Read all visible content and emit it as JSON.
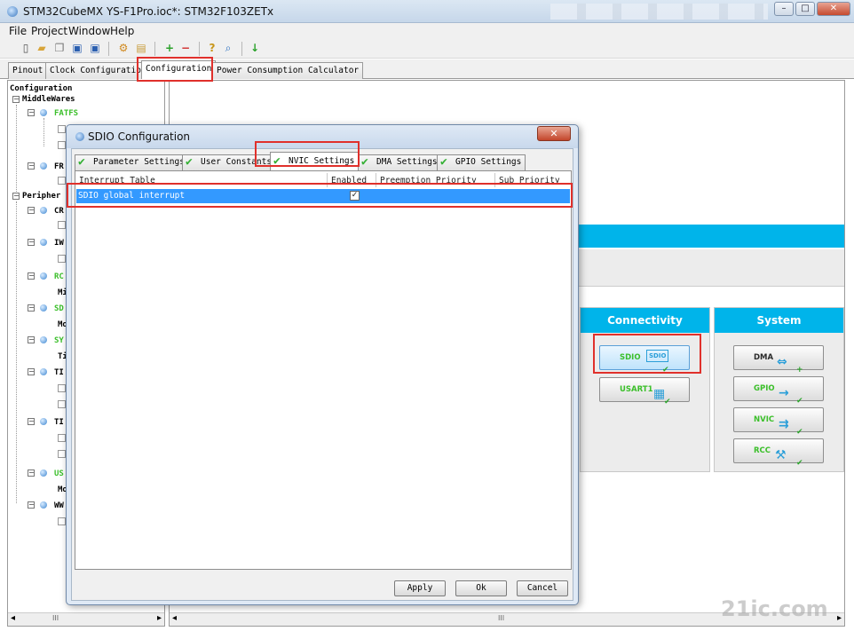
{
  "window": {
    "title": "STM32CubeMX YS-F1Pro.ioc*: STM32F103ZETx",
    "min_label": "–",
    "max_label": "□",
    "close_label": "✕"
  },
  "menu": [
    "File",
    "Project",
    "Window",
    "Help"
  ],
  "toolbar_icons": [
    "new-project-icon",
    "open-icon",
    "copy-icon",
    "save-icon",
    "save-as-icon",
    "generate-report-icon",
    "report-icon",
    "zoom-in-icon",
    "zoom-out-icon",
    "help-icon",
    "search-icon",
    "generate-code-icon"
  ],
  "main_tabs": [
    {
      "label": "Pinout"
    },
    {
      "label": "Clock Configuration"
    },
    {
      "label": "Configuration"
    },
    {
      "label": "Power Consumption Calculator"
    }
  ],
  "tree": {
    "root": "Configuration",
    "middlewares": "MiddleWares",
    "fatfs": "FATFS",
    "fr": "FR",
    "peripherals": "Peripher",
    "cr": "CR",
    "iw": "IW",
    "rc": "RC",
    "sd": "SD",
    "sy": "SY",
    "ti1": "TI",
    "ti2": "TI",
    "us": "US",
    "ww": "WW",
    "mi": "Mi",
    "mo1": "Mo",
    "mo2": "Mo",
    "ti_leaf": "Ti",
    "scroll_left": "◂",
    "scroll_right": "▸",
    "scroll_grip": "III"
  },
  "categories": {
    "connectivity": {
      "title": "Connectivity",
      "buttons": [
        {
          "label": "SDIO",
          "icon": "sdio-icon",
          "icon_text": "SDIO"
        },
        {
          "label": "USART1",
          "icon": "usart-icon",
          "icon_text": "▦"
        }
      ]
    },
    "system": {
      "title": "System",
      "buttons": [
        {
          "label": "DMA",
          "icon": "dma-icon",
          "icon_text": "⇔"
        },
        {
          "label": "GPIO",
          "icon": "gpio-icon",
          "icon_text": "→"
        },
        {
          "label": "NVIC",
          "icon": "nvic-icon",
          "icon_text": "⇉"
        },
        {
          "label": "RCC",
          "icon": "rcc-icon",
          "icon_text": "⚒"
        }
      ]
    }
  },
  "right_scroll": {
    "left": "◂",
    "right": "▸",
    "grip": "III"
  },
  "dialog": {
    "title": "SDIO Configuration",
    "close_label": "✕",
    "tabs": [
      {
        "label": "Parameter Settings"
      },
      {
        "label": "User Constants"
      },
      {
        "label": "NVIC Settings"
      },
      {
        "label": "DMA Settings"
      },
      {
        "label": "GPIO Settings"
      }
    ],
    "table": {
      "columns": [
        "Interrupt Table",
        "Enabled",
        "Preemption Priority",
        "Sub Priority"
      ],
      "rows": [
        {
          "name": "SDIO global interrupt",
          "enabled_mark": "✓",
          "preemption": "",
          "sub": ""
        }
      ]
    },
    "buttons": {
      "apply": "Apply",
      "ok": "Ok",
      "cancel": "Cancel"
    }
  },
  "check_mark": "✔",
  "watermark": "21ic.com",
  "colors": {
    "accent_cyan": "#00b4ea",
    "selection_blue": "#3399ff",
    "annotation_red": "#e0302b",
    "enabled_green": "#3bbf2a"
  }
}
